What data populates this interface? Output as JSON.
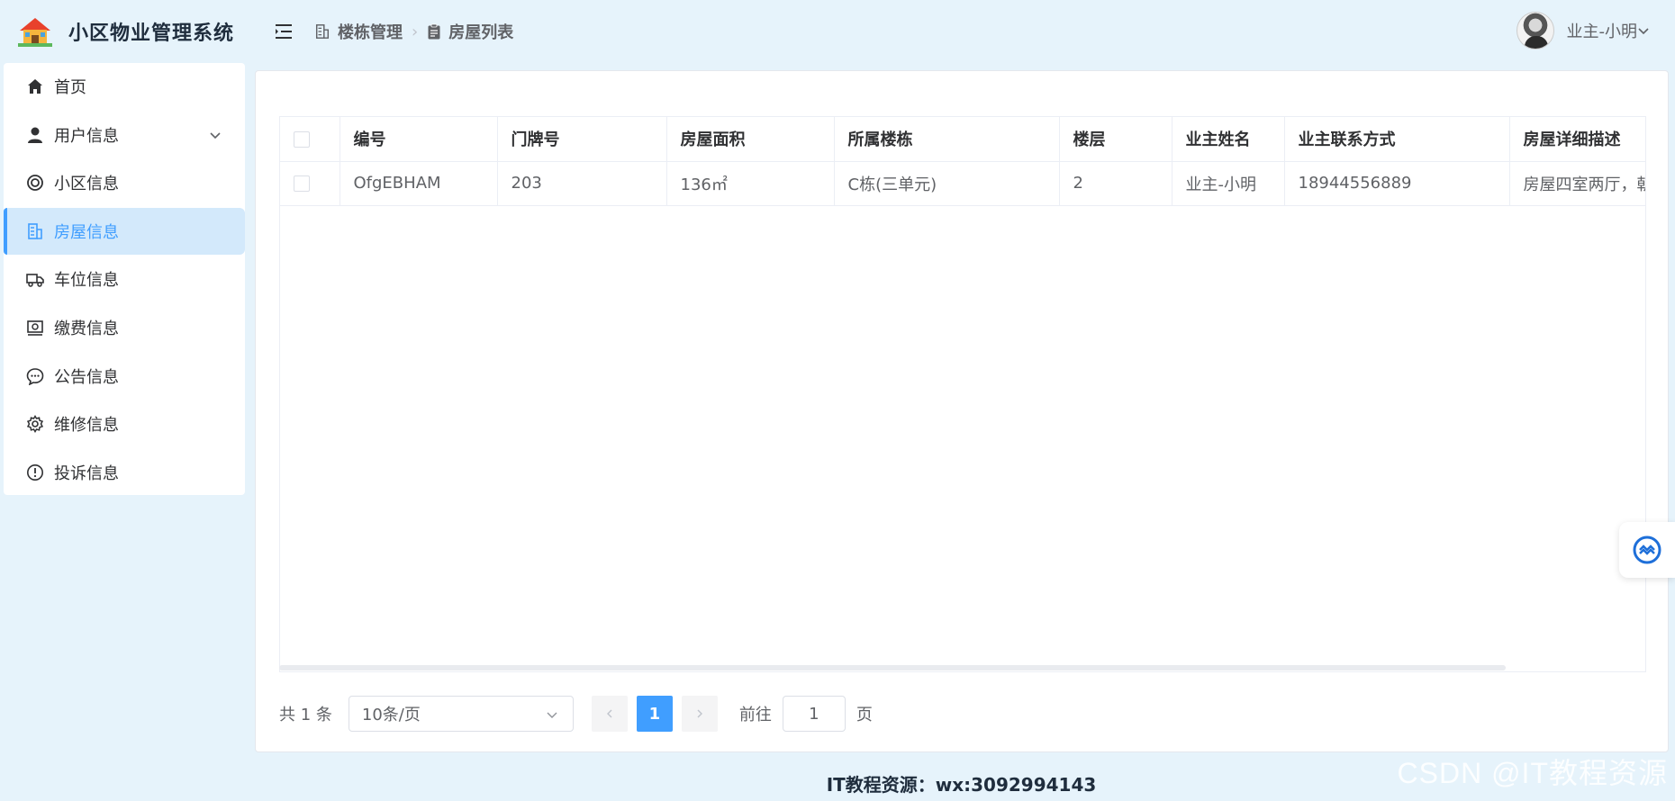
{
  "app": {
    "title": "小区物业管理系统"
  },
  "sidebar": {
    "items": [
      {
        "label": "首页",
        "icon": "home-icon"
      },
      {
        "label": "用户信息",
        "icon": "user-icon",
        "expandable": true
      },
      {
        "label": "小区信息",
        "icon": "community-icon"
      },
      {
        "label": "房屋信息",
        "icon": "building-icon",
        "active": true
      },
      {
        "label": "车位信息",
        "icon": "truck-icon"
      },
      {
        "label": "缴费信息",
        "icon": "payment-icon"
      },
      {
        "label": "公告信息",
        "icon": "chat-icon"
      },
      {
        "label": "维修信息",
        "icon": "gear-icon"
      },
      {
        "label": "投诉信息",
        "icon": "warning-icon"
      }
    ]
  },
  "header": {
    "breadcrumb": [
      "楼栋管理",
      "房屋列表"
    ],
    "user_name": "业主-小明"
  },
  "table": {
    "columns": [
      "编号",
      "门牌号",
      "房屋面积",
      "所属楼栋",
      "楼层",
      "业主姓名",
      "业主联系方式",
      "房屋详细描述"
    ],
    "rows": [
      [
        "OfgEBHAM",
        "203",
        "136㎡",
        "C栋(三单元)",
        "2",
        "业主-小明",
        "18944556889",
        "房屋四室两厅，朝"
      ]
    ]
  },
  "pagination": {
    "total": "共 1 条",
    "page_size": "10条/页",
    "current_page": "1",
    "goto_prefix": "前往",
    "goto_value": "1",
    "goto_suffix": "页"
  },
  "footer": {
    "text": "IT教程资源：wx:3092994143"
  },
  "watermark": "CSDN @IT教程资源",
  "colors": {
    "accent": "#409eff",
    "background": "#e6f3fb",
    "active_bg": "#d3e9fb"
  }
}
